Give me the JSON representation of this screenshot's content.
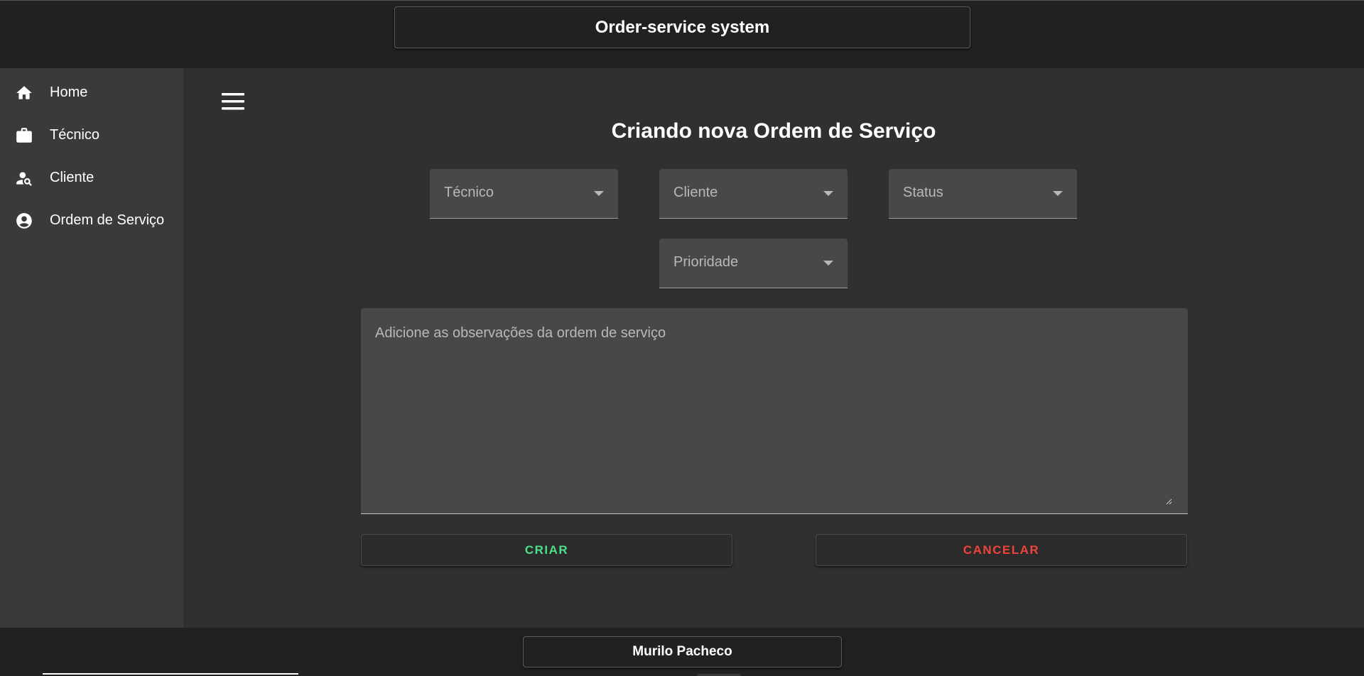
{
  "header": {
    "title": "Order-service system"
  },
  "sidebar": {
    "items": [
      {
        "label": "Home",
        "icon": "home-icon"
      },
      {
        "label": "Técnico",
        "icon": "briefcase-icon"
      },
      {
        "label": "Cliente",
        "icon": "person-search-icon"
      },
      {
        "label": "Ordem de Serviço",
        "icon": "account-circle-icon"
      }
    ]
  },
  "main": {
    "menu_icon": "menu-icon",
    "title": "Criando nova Ordem de Serviço",
    "selects": {
      "tecnico": "Técnico",
      "cliente": "Cliente",
      "status": "Status",
      "prioridade": "Prioridade"
    },
    "observacoes": {
      "value": "",
      "placeholder": "Adicione as observações da ordem de serviço"
    },
    "buttons": {
      "criar": "CRIAR",
      "cancelar": "CANCELAR"
    }
  },
  "footer": {
    "name": "Murilo Pacheco"
  },
  "colors": {
    "criar": "#4be08a",
    "cancelar": "#f2433a",
    "background": "#303030",
    "sidebar": "#3a3a3a",
    "bars": "#212121",
    "field": "#484848"
  }
}
